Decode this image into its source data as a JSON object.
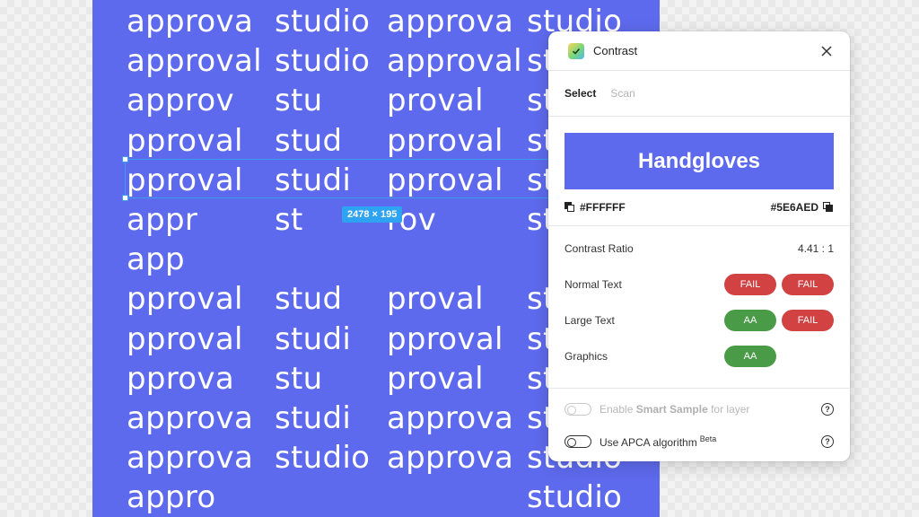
{
  "canvas": {
    "rows": [
      {
        "a": "approva",
        "b": "studio",
        "c": "approva",
        "d": "studio"
      },
      {
        "a": "approval",
        "b": "studio",
        "c": "approval",
        "d": "studio"
      },
      {
        "a": "approv",
        "b": "stu",
        "c": "proval",
        "d": "stu"
      },
      {
        "a": "pproval",
        "b": "stud",
        "c": "pproval",
        "d": "stu"
      },
      {
        "a": "pproval",
        "b": "studi",
        "c": "pproval",
        "d": "st"
      },
      {
        "a": "appr",
        "b": "st",
        "c": "rov",
        "d": "st"
      },
      {
        "a": "app",
        "b": "",
        "c": "",
        "d": ""
      },
      {
        "a": "pproval",
        "b": "stud",
        "c": "proval",
        "d": "st"
      },
      {
        "a": "pproval",
        "b": "studi",
        "c": "pproval",
        "d": "st"
      },
      {
        "a": "pprova",
        "b": "stu",
        "c": "proval",
        "d": "st"
      },
      {
        "a": "approva",
        "b": "studi",
        "c": "approva",
        "d": "st"
      },
      {
        "a": "approva",
        "b": "studio",
        "c": "approva",
        "d": "studio"
      },
      {
        "a": "appro",
        "b": "",
        "c": "",
        "d": "studio"
      }
    ],
    "selection_size_label": "2478 × 195"
  },
  "panel": {
    "title": "Contrast",
    "tabs": [
      {
        "label": "Select",
        "active": true
      },
      {
        "label": "Scan",
        "active": false
      }
    ],
    "preview_text": "Handgloves",
    "foreground_hex": "#FFFFFF",
    "background_hex": "#5E6AED",
    "contrast_ratio_label": "Contrast Ratio",
    "contrast_ratio_value": "4.41 : 1",
    "results": [
      {
        "label": "Normal Text",
        "aa": "FAIL",
        "aaa": "FAIL"
      },
      {
        "label": "Large Text",
        "aa": "AA",
        "aaa": "FAIL"
      },
      {
        "label": "Graphics",
        "aa": "AA",
        "aaa": ""
      }
    ],
    "options": [
      {
        "prefix": "Enable ",
        "bold": "Smart Sample",
        "suffix": " for layer",
        "sup": "",
        "enabled": false
      },
      {
        "prefix": "Use APCA algorithm",
        "bold": "",
        "suffix": "",
        "sup": "Beta",
        "enabled": true
      }
    ],
    "help_glyph": "?",
    "colors": {
      "accent": "#5E6AED",
      "fail": "#D24242",
      "pass": "#4A9B47"
    },
    "icons": {
      "app": "contrast-app-icon",
      "close": "close-icon",
      "help": "help-icon",
      "swatch": "swatch-icon"
    }
  }
}
